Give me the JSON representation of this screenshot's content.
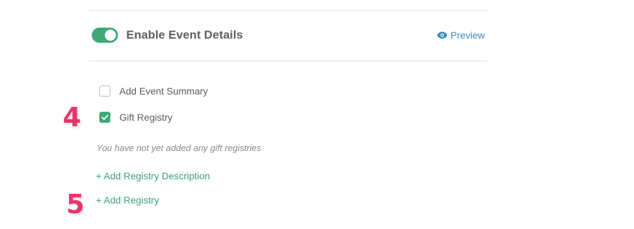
{
  "event_details": {
    "toggle_on": true,
    "title": "Enable Event Details",
    "preview_label": "Preview",
    "preview_icon": "eye-icon"
  },
  "options": [
    {
      "label": "Add Event Summary",
      "checked": false
    },
    {
      "label": "Gift Registry",
      "checked": true
    }
  ],
  "registry": {
    "empty_message": "You have not yet added any gift registries",
    "add_description_label": "+ Add Registry Description",
    "add_registry_label": "+ Add Registry"
  },
  "annotations": {
    "step_4": "4",
    "step_5": "5"
  },
  "colors": {
    "accent_green": "#43a878",
    "link_blue": "#3a87b6",
    "annotation_pink": "#e8346c"
  }
}
